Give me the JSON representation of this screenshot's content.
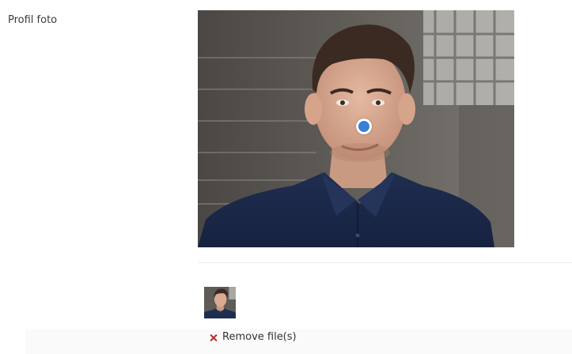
{
  "field": {
    "label": "Profil foto"
  },
  "photo": {
    "focal_point_color": "#3b7fd4"
  },
  "attachment": {
    "remove_label": "Remove file(s)",
    "remove_icon": "close-x-icon",
    "remove_icon_color": "#b72c2c"
  }
}
